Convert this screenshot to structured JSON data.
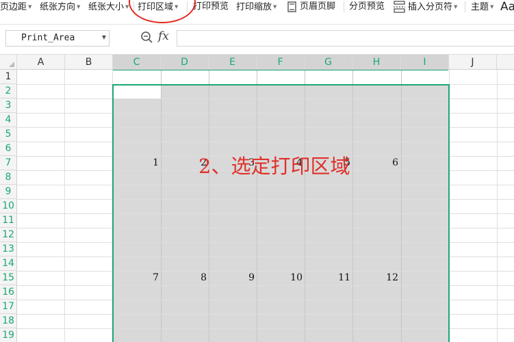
{
  "ribbon": {
    "margins": "页边距",
    "orientation": "纸张方向",
    "paper_size": "纸张大小",
    "print_area": "打印区域",
    "print_preview": "打印预览",
    "print_scale": "打印缩放",
    "header_footer": "页眉页脚",
    "page_break_preview": "分页预览",
    "insert_page_break": "插入分页符",
    "theme": "主题",
    "font_style": "Aa"
  },
  "formula_bar": {
    "name_box": "Print_Area",
    "fx": "fx",
    "formula": ""
  },
  "columns": [
    "A",
    "B",
    "C",
    "D",
    "E",
    "F",
    "G",
    "H",
    "I",
    "J"
  ],
  "rows": [
    "1",
    "2",
    "3",
    "4",
    "5",
    "6",
    "7",
    "8",
    "9",
    "10",
    "11",
    "12",
    "13",
    "14",
    "15",
    "16",
    "17",
    "18",
    "19"
  ],
  "cells": {
    "row7": [
      "1",
      "2",
      "3",
      "4",
      "5",
      "6"
    ],
    "row15": [
      "7",
      "8",
      "9",
      "10",
      "11",
      "12"
    ]
  },
  "annotation": "2、选定打印区域",
  "colors": {
    "selection_accent": "#1aa771",
    "annotation_red": "#e0302a",
    "selection_fill": "#d9d9d9"
  }
}
